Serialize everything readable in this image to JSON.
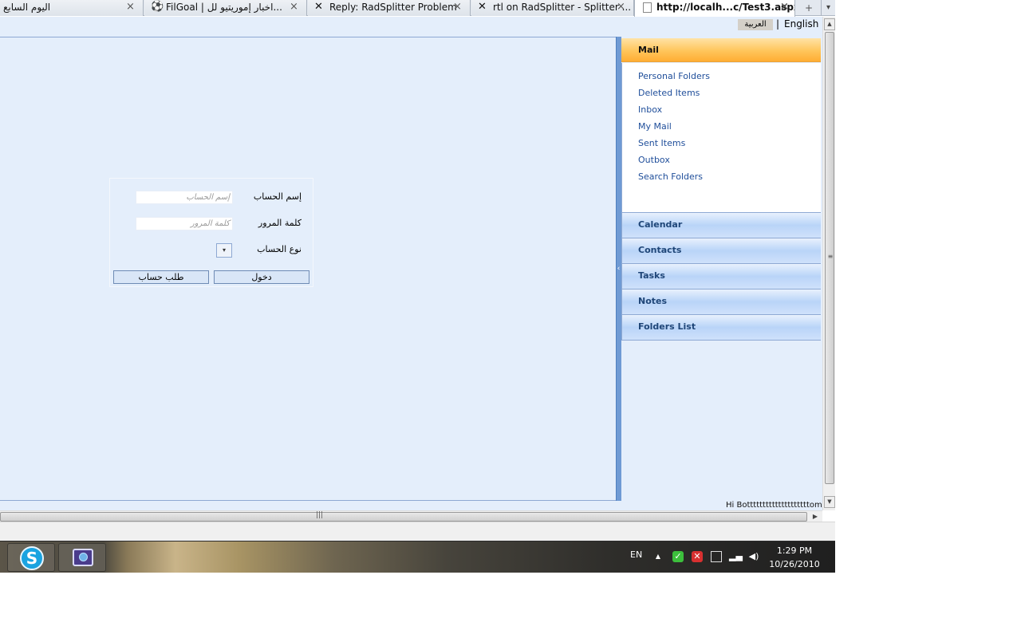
{
  "browser": {
    "tabs": [
      {
        "title": "اليوم السابع",
        "icon": "",
        "active": false
      },
      {
        "title": "FilGoal | اخبار إموريتيو لل...",
        "icon": "soccer-ball-icon",
        "active": false
      },
      {
        "title": "Reply: RadSplitter Problem",
        "icon": "telerik-icon",
        "active": false
      },
      {
        "title": "rtl on RadSplitter - Splitter ...",
        "icon": "telerik-icon",
        "active": false
      },
      {
        "title": "http://localh...c/Test3.aspx",
        "icon": "page-icon",
        "active": true
      }
    ],
    "close_glyph": "×",
    "new_tab_glyph": "+",
    "tab_list_glyph": "▾"
  },
  "language_bar": {
    "arabic": "العربية",
    "separator": "|",
    "english": "English"
  },
  "login": {
    "username_label": "إسم الحساب",
    "username_placeholder": "إسم الحساب",
    "password_label": "كلمة المرور",
    "password_placeholder": "كلمة المرور",
    "account_type_label": "نوع الحساب",
    "login_button": "دخول",
    "request_account_button": "طلب حساب"
  },
  "panel": {
    "mail_header": "Mail",
    "mail_items": [
      "Personal Folders",
      "Deleted Items",
      "Inbox",
      "My Mail",
      "Sent Items",
      "Outbox",
      "Search Folders"
    ],
    "groups": [
      "Calendar",
      "Contacts",
      "Tasks",
      "Notes",
      "Folders List"
    ]
  },
  "footer": {
    "text": "Hi Bottttttttttttttttttttom"
  },
  "taskbar": {
    "language": "EN",
    "time": "1:29 PM",
    "date": "10/26/2010",
    "pinned": [
      "skype-icon",
      "network-app-icon"
    ]
  },
  "colors": {
    "page_background": "#e4eefb",
    "mail_header": "#ffc55a",
    "link_blue": "#1f4e9a",
    "splitter": "#6f9ad4"
  }
}
